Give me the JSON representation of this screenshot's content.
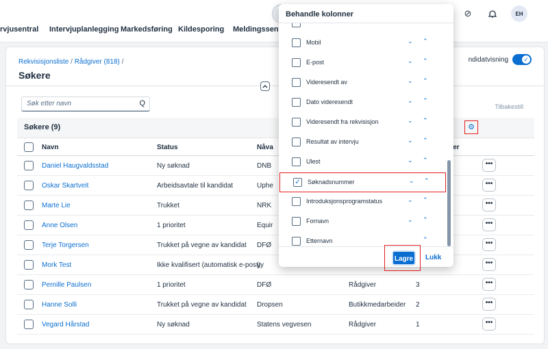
{
  "nav": {
    "tabs": [
      "rvjusentral",
      "Intervjuplanlegging",
      "Markedsføring",
      "Kildesporing",
      "Meldingssenter"
    ],
    "search_partial": "S",
    "avatar": "EH"
  },
  "page": {
    "breadcrumb": [
      "Rekvisisjonsliste",
      "Rådgiver (818)"
    ],
    "breadcrumb_sep": "/",
    "title": "Søkere",
    "kandidatvisning_label": "ndidatvisning",
    "kandidatvisning_on": true,
    "search_placeholder": "Søk etter navn",
    "tilbakestill_label": "Tilbakestill"
  },
  "table": {
    "title": "Søkere (9)",
    "headers": [
      "Navn",
      "Status",
      "Nåva",
      "",
      "ner"
    ],
    "rows": [
      {
        "name": "Daniel Haugvaldsstad",
        "status": "Ny søknad",
        "employer": "DNB",
        "title": "",
        "num": ""
      },
      {
        "name": "Oskar Skartveit",
        "status": "Arbeidsavtale til kandidat",
        "employer": "Uphe",
        "title": "",
        "num": ""
      },
      {
        "name": "Marte Lie",
        "status": "Trukket",
        "employer": "NRK",
        "title": "",
        "num": ""
      },
      {
        "name": "Anne Olsen",
        "status": "1 prioritet",
        "employer": "Equir",
        "title": "",
        "num": ""
      },
      {
        "name": "Terje Torgersen",
        "status": "Trukket på vegne av kandidat",
        "employer": "DFØ",
        "title": "",
        "num": ""
      },
      {
        "name": "Mork Test",
        "status": "Ikke kvalifisert (automatisk e-post)",
        "employer": "yy",
        "title": "",
        "num": ""
      },
      {
        "name": "Pernille Paulsen",
        "status": "1 prioritet",
        "employer": "DFØ",
        "title": "Rådgiver",
        "num": "3"
      },
      {
        "name": "Hanne Solli",
        "status": "Trukket på vegne av kandidat",
        "employer": "Dropsen",
        "title": "Butikkmedarbeider",
        "num": "2"
      },
      {
        "name": "Vegard Hårstad",
        "status": "Ny søknad",
        "employer": "Statens vegvesen",
        "title": "Rådgiver",
        "num": "1"
      }
    ],
    "more_label": "•••"
  },
  "modal": {
    "title": "Behandle kolonner",
    "items": [
      {
        "label": "",
        "checked": false
      },
      {
        "label": "Mobil",
        "checked": false
      },
      {
        "label": "E-post",
        "checked": false
      },
      {
        "label": "Videresendt av",
        "checked": false
      },
      {
        "label": "Dato videresendt",
        "checked": false
      },
      {
        "label": "Videresendt fra rekvisisjon",
        "checked": false
      },
      {
        "label": "Resultat av intervju",
        "checked": false
      },
      {
        "label": "Ulest",
        "checked": false
      },
      {
        "label": "Søknadsnummer",
        "checked": true
      },
      {
        "label": "Introduksjonsprogramstatus",
        "checked": false
      },
      {
        "label": "Fornavn",
        "checked": false
      },
      {
        "label": "Etternavn",
        "checked": false
      }
    ],
    "save_label": "Lagre",
    "close_label": "Lukk"
  },
  "colors": {
    "accent": "#0a6ed1",
    "highlight": "#e41e1e"
  }
}
